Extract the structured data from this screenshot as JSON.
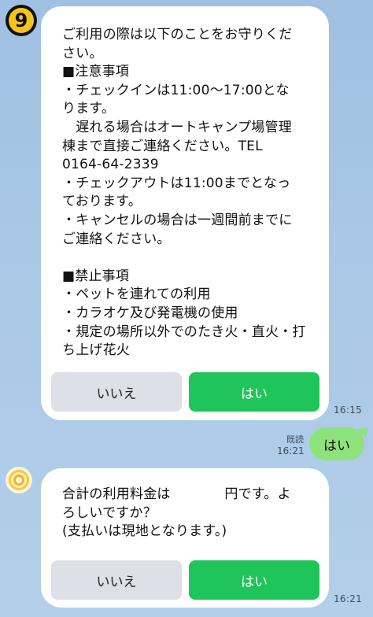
{
  "badge": {
    "number": "9"
  },
  "messages": {
    "bot_message_1": {
      "text": "ご利用の際は以下のことをお守りくだ\nさい。\n■注意事項\n・チェックインは11:00～17:00とな\nります。\n　遅れる場合はオートキャンプ場管理\n棟まで直接ご連絡ください。TEL\n0164-64-2339\n・チェックアウトは11:00までとなっ\nております。\n・キャンセルの場合は一週間前までに\nご連絡ください。\n\n■禁止事項\n・ペットを連れての利用\n・カラオケ及び発電機の使用\n・規定の場所以外でのたき火・直火・打\nち上げ花火",
      "button_no": "いいえ",
      "button_yes": "はい",
      "time": "16:15"
    },
    "user_message": {
      "text": "はい",
      "read_status": "既読",
      "time": "16:21"
    },
    "bot_message_2": {
      "text": "合計の利用料金は　　　　円です。よ\nろしいですか？\n(支払いは現地となります。)",
      "button_no": "いいえ",
      "button_yes": "はい",
      "time": "16:21"
    }
  },
  "colors": {
    "background": "#a9c8e7",
    "yes_button": "#1fc45b",
    "no_button": "#dde0e6",
    "user_bubble": "#8ee27c",
    "badge": "#f6c31a"
  },
  "icons": {
    "badge": "number-9-badge",
    "avatar": "camp-logo-avatar"
  }
}
